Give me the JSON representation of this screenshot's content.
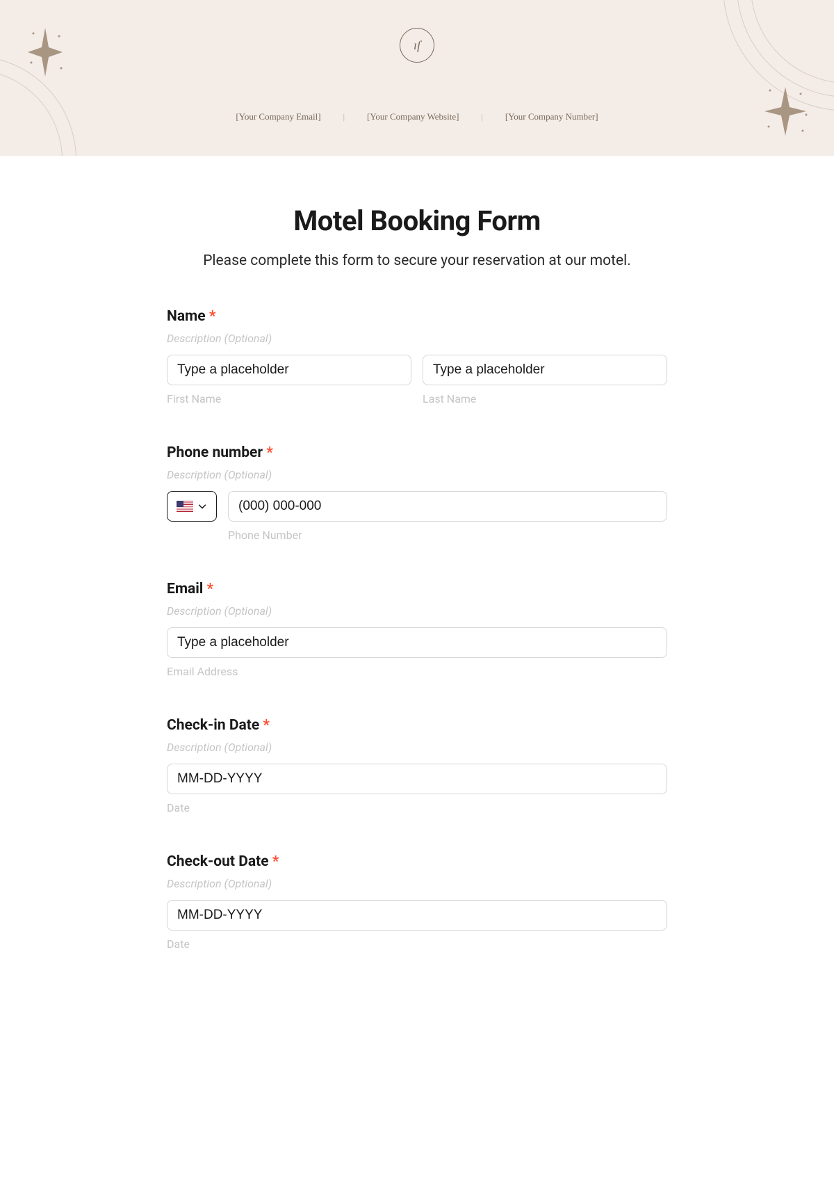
{
  "header": {
    "email": "[Your Company Email]",
    "website": "[Your Company Website]",
    "phone": "[Your Company Number]"
  },
  "form": {
    "title": "Motel Booking Form",
    "subtitle": "Please complete this form to secure your reservation at our motel.",
    "required_marker": "*",
    "desc_placeholder": "Description (Optional)",
    "fields": {
      "name": {
        "label": "Name",
        "first_placeholder": "Type a placeholder",
        "last_placeholder": "Type a placeholder",
        "first_sub": "First Name",
        "last_sub": "Last Name"
      },
      "phone": {
        "label": "Phone number",
        "placeholder": "(000) 000-000",
        "sub": "Phone Number"
      },
      "email": {
        "label": "Email",
        "placeholder": "Type a placeholder",
        "sub": "Email Address"
      },
      "checkin": {
        "label": "Check-in Date",
        "placeholder": "MM-DD-YYYY",
        "sub": "Date"
      },
      "checkout": {
        "label": "Check-out Date",
        "placeholder": "MM-DD-YYYY",
        "sub": "Date"
      }
    }
  }
}
